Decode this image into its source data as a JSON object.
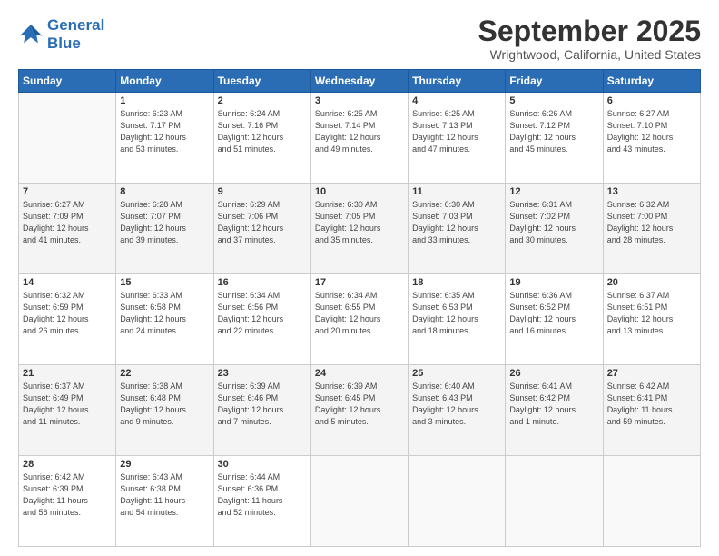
{
  "logo": {
    "line1": "General",
    "line2": "Blue"
  },
  "title": "September 2025",
  "location": "Wrightwood, California, United States",
  "weekdays": [
    "Sunday",
    "Monday",
    "Tuesday",
    "Wednesday",
    "Thursday",
    "Friday",
    "Saturday"
  ],
  "weeks": [
    [
      {
        "day": "",
        "info": ""
      },
      {
        "day": "1",
        "info": "Sunrise: 6:23 AM\nSunset: 7:17 PM\nDaylight: 12 hours\nand 53 minutes."
      },
      {
        "day": "2",
        "info": "Sunrise: 6:24 AM\nSunset: 7:16 PM\nDaylight: 12 hours\nand 51 minutes."
      },
      {
        "day": "3",
        "info": "Sunrise: 6:25 AM\nSunset: 7:14 PM\nDaylight: 12 hours\nand 49 minutes."
      },
      {
        "day": "4",
        "info": "Sunrise: 6:25 AM\nSunset: 7:13 PM\nDaylight: 12 hours\nand 47 minutes."
      },
      {
        "day": "5",
        "info": "Sunrise: 6:26 AM\nSunset: 7:12 PM\nDaylight: 12 hours\nand 45 minutes."
      },
      {
        "day": "6",
        "info": "Sunrise: 6:27 AM\nSunset: 7:10 PM\nDaylight: 12 hours\nand 43 minutes."
      }
    ],
    [
      {
        "day": "7",
        "info": "Sunrise: 6:27 AM\nSunset: 7:09 PM\nDaylight: 12 hours\nand 41 minutes."
      },
      {
        "day": "8",
        "info": "Sunrise: 6:28 AM\nSunset: 7:07 PM\nDaylight: 12 hours\nand 39 minutes."
      },
      {
        "day": "9",
        "info": "Sunrise: 6:29 AM\nSunset: 7:06 PM\nDaylight: 12 hours\nand 37 minutes."
      },
      {
        "day": "10",
        "info": "Sunrise: 6:30 AM\nSunset: 7:05 PM\nDaylight: 12 hours\nand 35 minutes."
      },
      {
        "day": "11",
        "info": "Sunrise: 6:30 AM\nSunset: 7:03 PM\nDaylight: 12 hours\nand 33 minutes."
      },
      {
        "day": "12",
        "info": "Sunrise: 6:31 AM\nSunset: 7:02 PM\nDaylight: 12 hours\nand 30 minutes."
      },
      {
        "day": "13",
        "info": "Sunrise: 6:32 AM\nSunset: 7:00 PM\nDaylight: 12 hours\nand 28 minutes."
      }
    ],
    [
      {
        "day": "14",
        "info": "Sunrise: 6:32 AM\nSunset: 6:59 PM\nDaylight: 12 hours\nand 26 minutes."
      },
      {
        "day": "15",
        "info": "Sunrise: 6:33 AM\nSunset: 6:58 PM\nDaylight: 12 hours\nand 24 minutes."
      },
      {
        "day": "16",
        "info": "Sunrise: 6:34 AM\nSunset: 6:56 PM\nDaylight: 12 hours\nand 22 minutes."
      },
      {
        "day": "17",
        "info": "Sunrise: 6:34 AM\nSunset: 6:55 PM\nDaylight: 12 hours\nand 20 minutes."
      },
      {
        "day": "18",
        "info": "Sunrise: 6:35 AM\nSunset: 6:53 PM\nDaylight: 12 hours\nand 18 minutes."
      },
      {
        "day": "19",
        "info": "Sunrise: 6:36 AM\nSunset: 6:52 PM\nDaylight: 12 hours\nand 16 minutes."
      },
      {
        "day": "20",
        "info": "Sunrise: 6:37 AM\nSunset: 6:51 PM\nDaylight: 12 hours\nand 13 minutes."
      }
    ],
    [
      {
        "day": "21",
        "info": "Sunrise: 6:37 AM\nSunset: 6:49 PM\nDaylight: 12 hours\nand 11 minutes."
      },
      {
        "day": "22",
        "info": "Sunrise: 6:38 AM\nSunset: 6:48 PM\nDaylight: 12 hours\nand 9 minutes."
      },
      {
        "day": "23",
        "info": "Sunrise: 6:39 AM\nSunset: 6:46 PM\nDaylight: 12 hours\nand 7 minutes."
      },
      {
        "day": "24",
        "info": "Sunrise: 6:39 AM\nSunset: 6:45 PM\nDaylight: 12 hours\nand 5 minutes."
      },
      {
        "day": "25",
        "info": "Sunrise: 6:40 AM\nSunset: 6:43 PM\nDaylight: 12 hours\nand 3 minutes."
      },
      {
        "day": "26",
        "info": "Sunrise: 6:41 AM\nSunset: 6:42 PM\nDaylight: 12 hours\nand 1 minute."
      },
      {
        "day": "27",
        "info": "Sunrise: 6:42 AM\nSunset: 6:41 PM\nDaylight: 11 hours\nand 59 minutes."
      }
    ],
    [
      {
        "day": "28",
        "info": "Sunrise: 6:42 AM\nSunset: 6:39 PM\nDaylight: 11 hours\nand 56 minutes."
      },
      {
        "day": "29",
        "info": "Sunrise: 6:43 AM\nSunset: 6:38 PM\nDaylight: 11 hours\nand 54 minutes."
      },
      {
        "day": "30",
        "info": "Sunrise: 6:44 AM\nSunset: 6:36 PM\nDaylight: 11 hours\nand 52 minutes."
      },
      {
        "day": "",
        "info": ""
      },
      {
        "day": "",
        "info": ""
      },
      {
        "day": "",
        "info": ""
      },
      {
        "day": "",
        "info": ""
      }
    ]
  ]
}
